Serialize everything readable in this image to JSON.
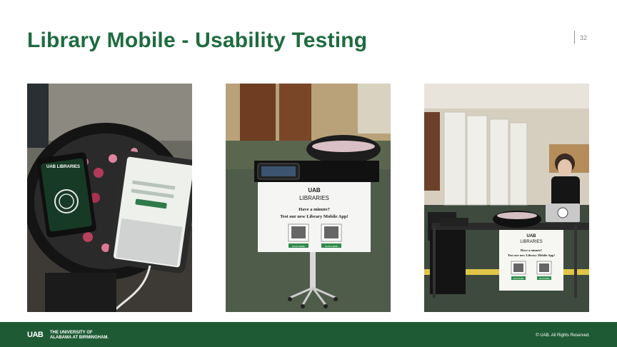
{
  "slide": {
    "title": "Library Mobile - Usability Testing",
    "page_number": "32"
  },
  "photos": {
    "photo1": {
      "brand": "UAB LIBRARIES"
    },
    "photo2": {
      "logo": "UAB",
      "heading": "LIBRARIES",
      "line1": "Have a minute?",
      "line2": "Test our new Library Mobile App!",
      "qr_left_label": "SCAN HERE",
      "qr_right_label": "SCAN HERE"
    },
    "photo3": {
      "logo": "UAB",
      "heading": "LIBRARIES",
      "line1": "Have a minute?",
      "line2": "Test our new Library Mobile App!",
      "qr_left_label": "SCAN HERE",
      "qr_right_label": "SCAN HERE"
    }
  },
  "footer": {
    "logo": "UAB",
    "institution_line1": "THE UNIVERSITY OF",
    "institution_line2": "ALABAMA AT BIRMINGHAM.",
    "copyright": "© UAB. All Rights Reserved."
  },
  "colors": {
    "brand_green": "#1e6b3f",
    "footer_green": "#1e5b35"
  }
}
